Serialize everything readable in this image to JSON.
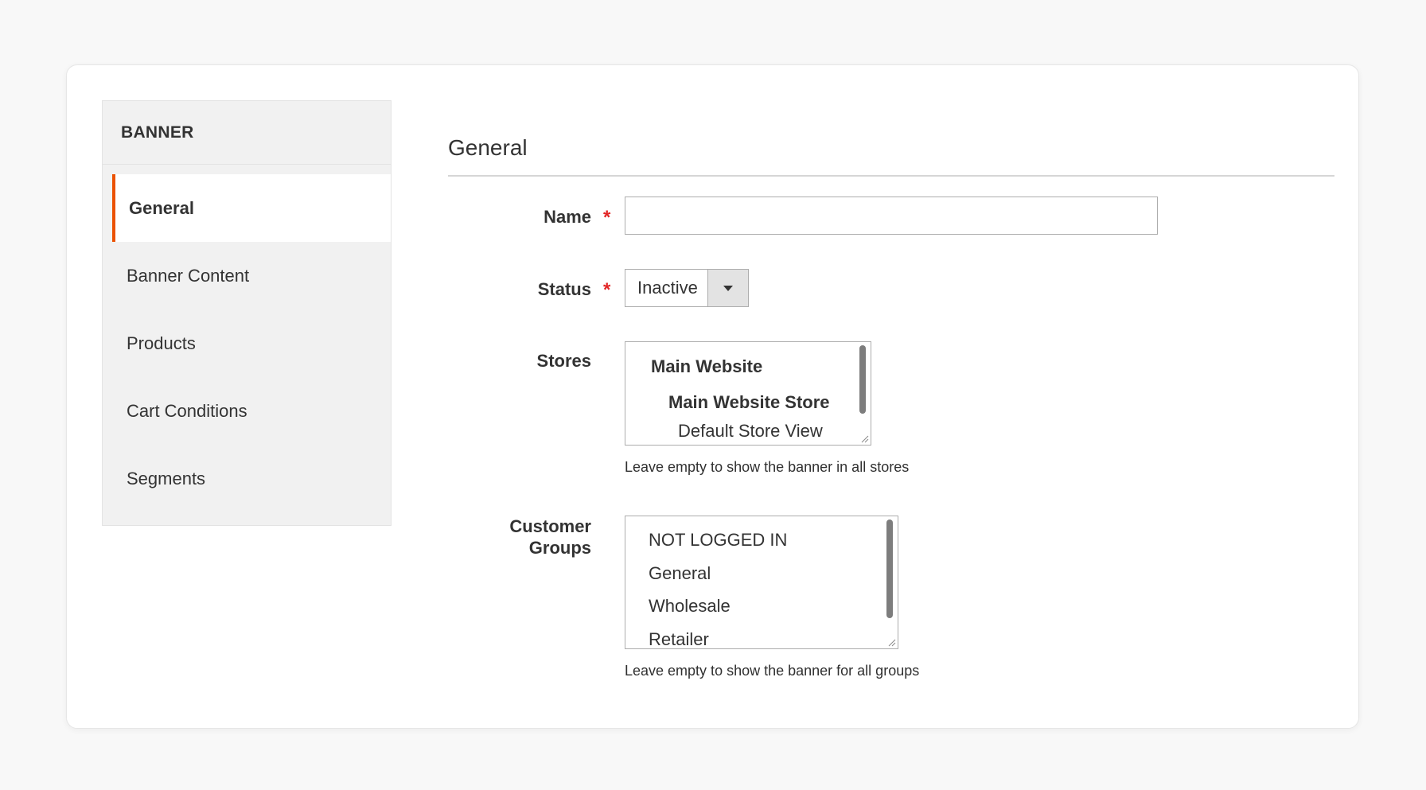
{
  "sidebar": {
    "header": "BANNER",
    "items": [
      {
        "label": "General"
      },
      {
        "label": "Banner Content"
      },
      {
        "label": "Products"
      },
      {
        "label": "Cart Conditions"
      },
      {
        "label": "Segments"
      }
    ],
    "active_item": "General"
  },
  "main": {
    "section_title": "General",
    "name": {
      "label": "Name",
      "required_mark": "*",
      "value": ""
    },
    "status": {
      "label": "Status",
      "required_mark": "*",
      "value": "Inactive"
    },
    "stores": {
      "label": "Stores",
      "options": [
        {
          "text": "Main Website"
        },
        {
          "text": "Main Website Store"
        },
        {
          "text": "Default Store View"
        }
      ],
      "note": "Leave empty to show the banner in all stores"
    },
    "customer_groups": {
      "label_line1": "Customer",
      "label_line2": "Groups",
      "options": [
        {
          "text": "NOT LOGGED IN"
        },
        {
          "text": "General"
        },
        {
          "text": "Wholesale"
        },
        {
          "text": "Retailer"
        }
      ],
      "note": "Leave empty to show the banner for all groups"
    }
  },
  "colors": {
    "accent": "#eb5202",
    "required": "#e22626",
    "sidebar_bg": "#f1f1f1",
    "page_bg": "#f8f8f8"
  }
}
